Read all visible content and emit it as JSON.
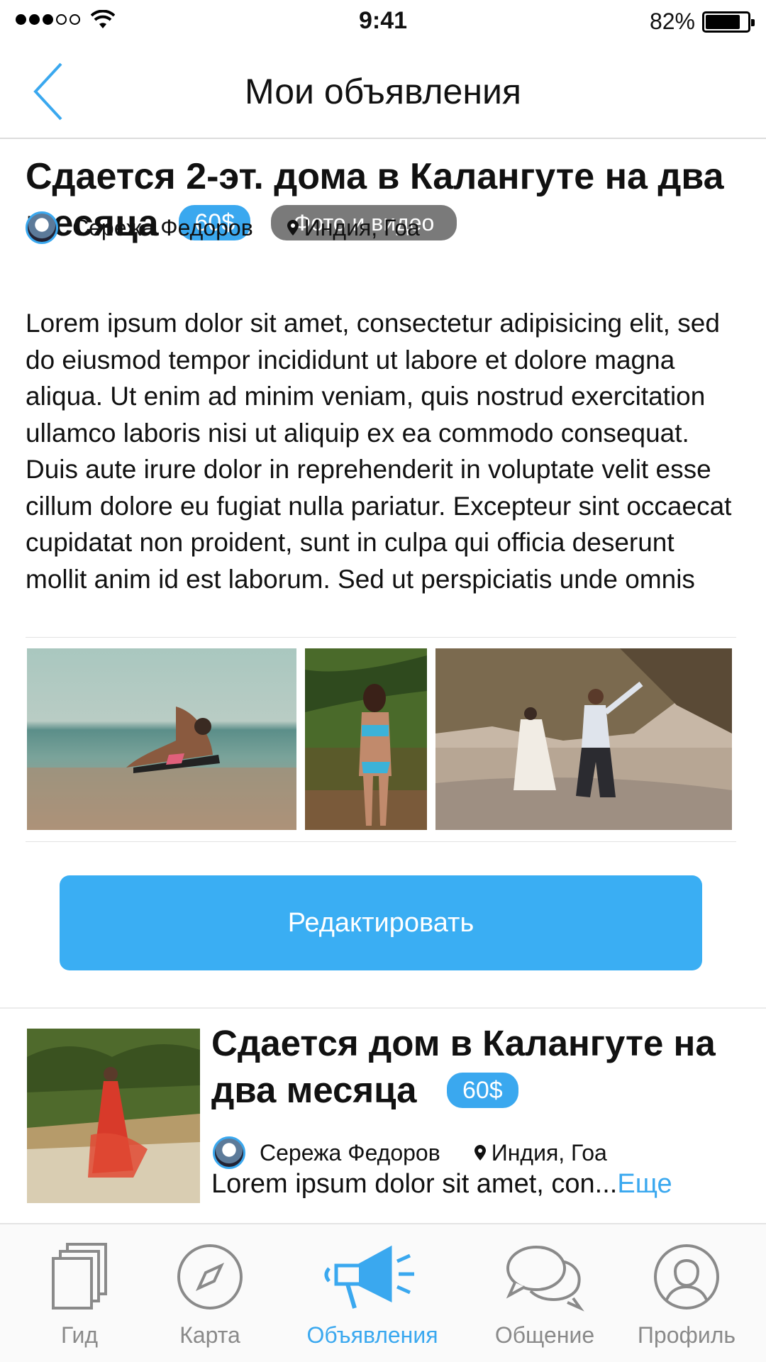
{
  "status_bar": {
    "time": "9:41",
    "battery": "82%",
    "battery_level": 0.82
  },
  "nav": {
    "title": "Мои объявления"
  },
  "listing1": {
    "title": "Сдается 2-эт. дома в Калангуте на два месяца",
    "price": "60$",
    "media_badge": "Фото и видео",
    "author": "Сережа Федоров",
    "location": "Индия, Гоа",
    "description": "Lorem ipsum dolor sit amet, consectetur adipisicing elit, sed do eiusmod tempor incididunt ut labore et dolore magna aliqua. Ut enim ad minim veniam, quis nostrud exercitation ullamco laboris nisi ut aliquip ex ea commodo consequat. Duis aute irure dolor in reprehenderit in voluptate velit esse cillum dolore eu fugiat nulla pariatur. Excepteur sint occaecat cupidatat non proident, sunt in culpa qui officia deserunt mollit anim id est laborum. Sed ut perspiciatis unde omnis",
    "edit_label": "Редактировать"
  },
  "listing2": {
    "title": "Сдается дом в Калангуте на два месяца",
    "price": "60$",
    "author": "Сережа Федоров",
    "location": "Индия, Гоа",
    "description": "Lorem ipsum dolor sit amet, con...",
    "more": "Еще"
  },
  "tabs": [
    {
      "label": "Гид",
      "icon": "pages-icon",
      "active": false
    },
    {
      "label": "Карта",
      "icon": "compass-icon",
      "active": false
    },
    {
      "label": "Объявления",
      "icon": "megaphone-icon",
      "active": true
    },
    {
      "label": "Общение",
      "icon": "chat-bubbles-icon",
      "active": false
    },
    {
      "label": "Профиль",
      "icon": "profile-icon",
      "active": false
    }
  ],
  "colors": {
    "accent": "#3aa8ef",
    "badge_gray": "#7a7a7a",
    "inactive_tab": "#8a8a8a"
  }
}
